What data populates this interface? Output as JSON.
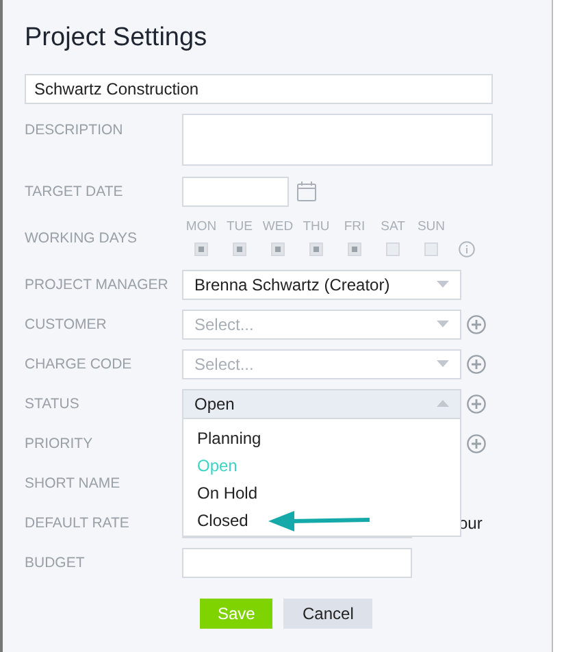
{
  "window": {
    "title": "Project Settings"
  },
  "name_field": {
    "value": "Schwartz Construction"
  },
  "fields": [
    {
      "kind": "textarea",
      "label": "DESCRIPTION"
    },
    {
      "kind": "date",
      "label": "TARGET DATE"
    },
    {
      "kind": "days",
      "label": "WORKING DAYS",
      "days": [
        {
          "label": "MON",
          "checked": true
        },
        {
          "label": "TUE",
          "checked": true
        },
        {
          "label": "WED",
          "checked": true
        },
        {
          "label": "THU",
          "checked": true
        },
        {
          "label": "FRI",
          "checked": true
        },
        {
          "label": "SAT",
          "checked": false
        },
        {
          "label": "SUN",
          "checked": false
        }
      ]
    },
    {
      "kind": "select",
      "label": "PROJECT MANAGER",
      "value": "Brenna Schwartz (Creator)",
      "add": false
    },
    {
      "kind": "select",
      "label": "CUSTOMER",
      "placeholder": "Select...",
      "add": true
    },
    {
      "kind": "select",
      "label": "CHARGE CODE",
      "placeholder": "Select...",
      "add": true
    },
    {
      "kind": "select",
      "label": "STATUS",
      "value": "Open",
      "add": true,
      "expanded": true,
      "options": [
        {
          "label": "Planning",
          "selected": false
        },
        {
          "label": "Open",
          "selected": true
        },
        {
          "label": "On Hold",
          "selected": false
        },
        {
          "label": "Closed",
          "selected": false
        }
      ]
    },
    {
      "kind": "covered",
      "label": "PRIORITY",
      "add": true
    },
    {
      "kind": "covered",
      "label": "SHORT NAME",
      "add": false
    },
    {
      "kind": "text",
      "label": "DEFAULT RATE",
      "suffix": "our"
    },
    {
      "kind": "text",
      "label": "BUDGET"
    }
  ],
  "buttons": [
    {
      "label": "Save",
      "kind": "primary"
    },
    {
      "label": "Cancel",
      "kind": "secondary"
    }
  ]
}
